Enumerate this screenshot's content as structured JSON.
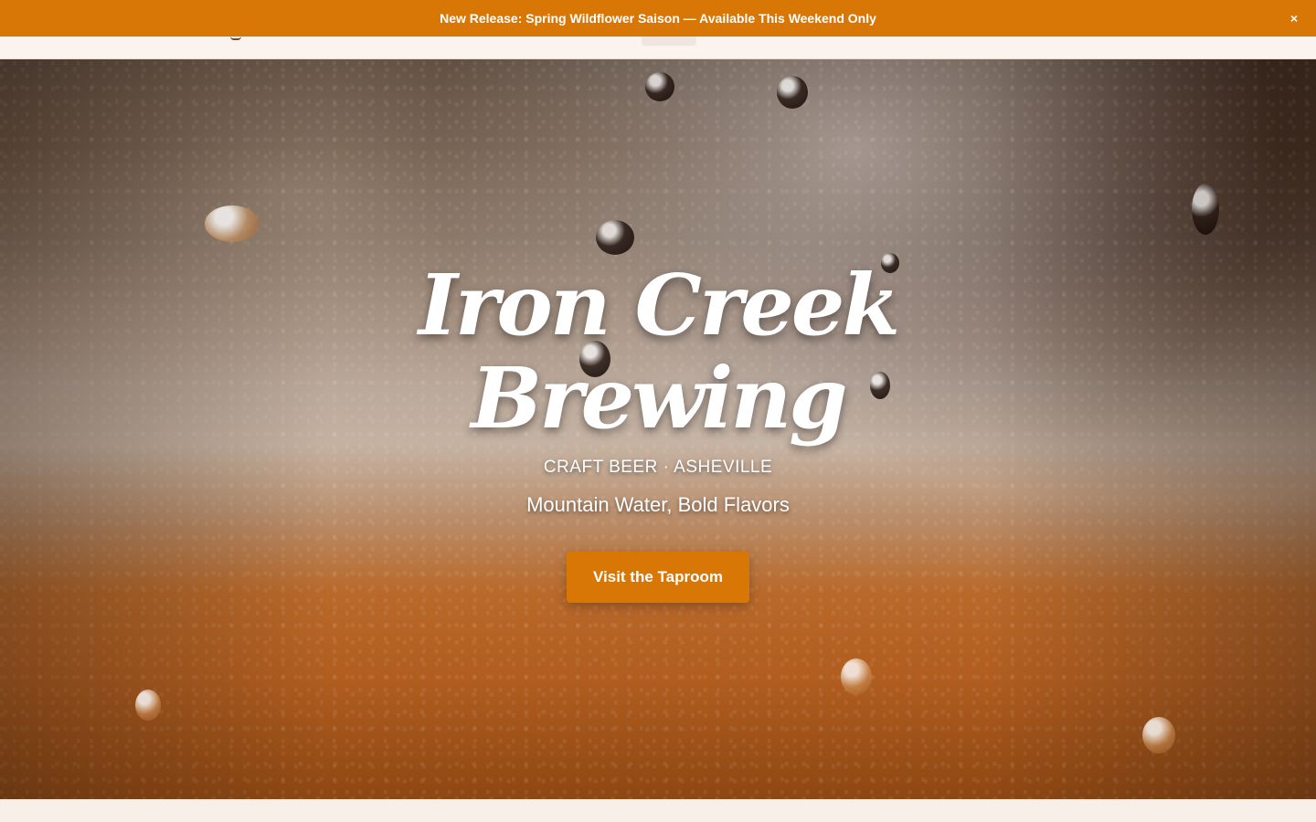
{
  "announcement": {
    "text": "New Release: Spring Wildflower Saison — Available This Weekend Only",
    "close_label": "×"
  },
  "hero": {
    "title_line1": "Iron Creek",
    "title_line2": "Brewing",
    "tagline": "CRAFT BEER · ASHEVILLE",
    "subtitle": "Mountain Water, Bold Flavors",
    "cta_label": "Visit the Taproom"
  },
  "colors": {
    "accent": "#d97706",
    "page_background": "#f8f0e8",
    "hero_text": "#ffffff"
  }
}
